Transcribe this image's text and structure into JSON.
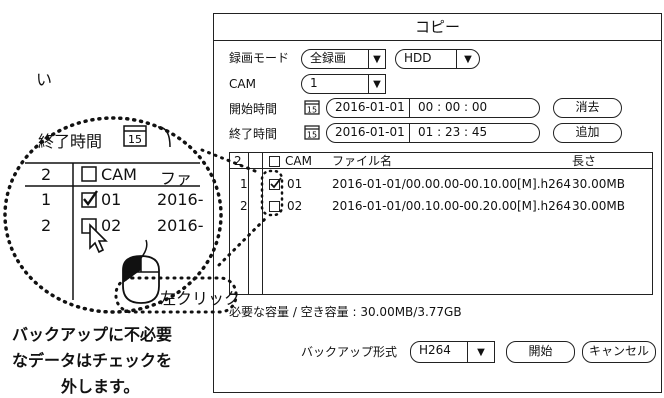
{
  "dialog": {
    "title": "コピー",
    "record_mode_label": "録画モード",
    "record_mode_value": "全録画",
    "device_value": "HDD",
    "cam_label": "CAM",
    "cam_value": "1",
    "start_label": "開始時間",
    "start_date": "2016-01-01",
    "start_time": "00 : 00 : 00",
    "clear_button": "消去",
    "end_label": "終了時間",
    "end_date": "2016-01-01",
    "end_time": "01 : 23 : 45",
    "add_button": "追加",
    "calendar_day": "15",
    "table": {
      "count": "2",
      "headers": {
        "cam": "CAM",
        "file": "ファイル名",
        "length": "長さ"
      },
      "rows": [
        {
          "no": "1",
          "checked": true,
          "cam": "01",
          "file": "2016-01-01/00.00.00-00.10.00[M].h264",
          "length": "30.00MB"
        },
        {
          "no": "2",
          "checked": false,
          "cam": "02",
          "file": "2016-01-01/00.10.00-00.20.00[M].h264",
          "length": "30.00MB"
        }
      ]
    },
    "capacity_text": "必要な容量 / 空き容量 : 30.00MB/3.77GB",
    "format_label": "バックアップ形式",
    "format_value": "H264",
    "start_button": "開始",
    "cancel_button": "キャンセル"
  },
  "zoom": {
    "partial_text": "い",
    "end_label_partial": "終了時間",
    "count": "2",
    "cam": "CAM",
    "file_partial": "ファ",
    "rows": [
      {
        "no": "1",
        "checked": true,
        "cam": "01",
        "file_partial": "2016-"
      },
      {
        "no": "2",
        "checked": false,
        "cam": "02",
        "file_partial": "2016-"
      }
    ],
    "click_label": "左クリック"
  },
  "note": {
    "line1": "バックアップに不必要",
    "line2": "なデータはチェックを",
    "line3": "外します。"
  }
}
